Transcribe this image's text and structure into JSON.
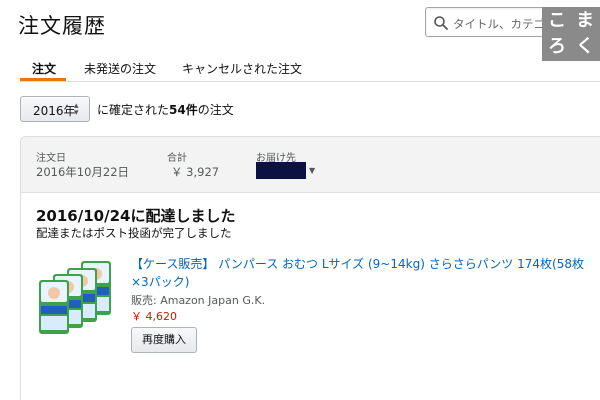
{
  "page": {
    "title": "注文履歴"
  },
  "search": {
    "placeholder": "タイトル、カテゴリー、また"
  },
  "logo": {
    "chars": [
      "こ",
      "ま",
      "ろ",
      "く"
    ]
  },
  "tabs": [
    {
      "label": "注文",
      "active": true
    },
    {
      "label": "未発送の注文",
      "active": false
    },
    {
      "label": "キャンセルされた注文",
      "active": false
    }
  ],
  "filter": {
    "year": "2016年",
    "summary_prefix": "に確定された",
    "count": "54件",
    "summary_suffix": "の注文"
  },
  "order": {
    "date_label": "注文日",
    "date_value": "2016年10月22日",
    "total_label": "合計",
    "total_value": "￥ 3,927",
    "ship_to_label": "お届け先",
    "status_title": "2016/10/24に配達しました",
    "status_sub": "配達またはポスト投函が完了しました",
    "item": {
      "title": "【ケース販売】 パンパース おむつ Lサイズ (9~14kg) さらさらパンツ 174枚(58枚×3パック)",
      "seller": "販売: Amazon Japan G.K.",
      "price": "￥ 4,620",
      "rebuy_label": "再度購入"
    }
  },
  "colors": {
    "accent": "#e47911",
    "link": "#0066c0",
    "price": "#b12704",
    "header_bg": "#f3f3f3"
  }
}
